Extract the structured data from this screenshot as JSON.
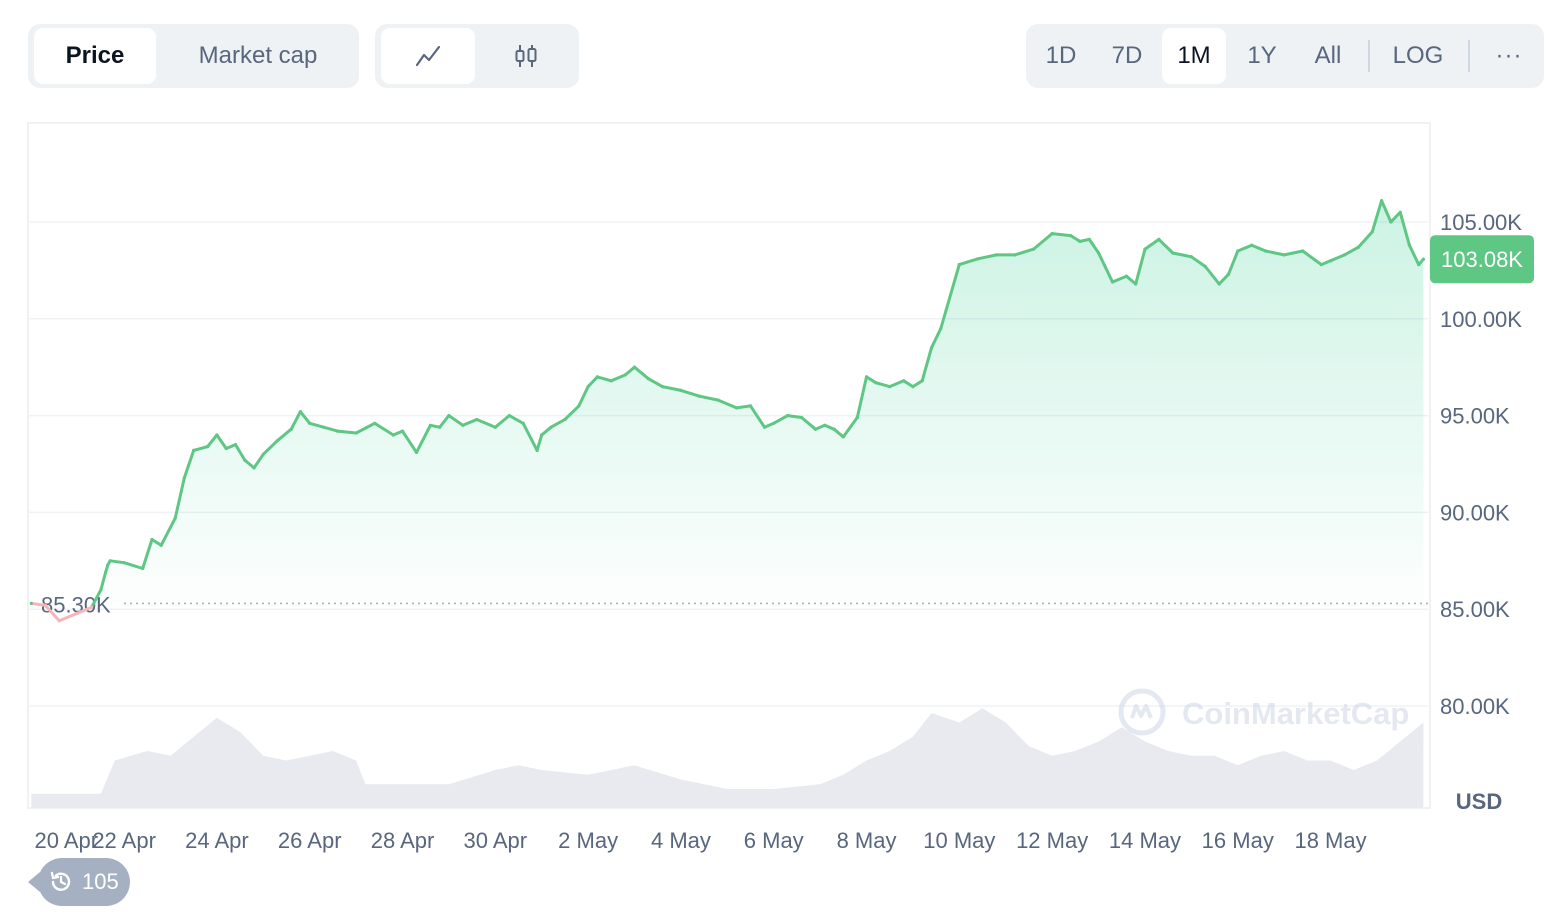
{
  "toolbar": {
    "metric_tabs": [
      {
        "label": "Price",
        "active": true
      },
      {
        "label": "Market cap",
        "active": false
      }
    ],
    "chart_type_buttons": [
      {
        "icon": "line-chart-icon",
        "active": true
      },
      {
        "icon": "candlestick-icon",
        "active": false
      }
    ],
    "timeframes": [
      {
        "label": "1D",
        "active": false
      },
      {
        "label": "7D",
        "active": false
      },
      {
        "label": "1M",
        "active": true
      },
      {
        "label": "1Y",
        "active": false
      },
      {
        "label": "All",
        "active": false
      }
    ],
    "log_label": "LOG",
    "more_label": "···"
  },
  "watermark": "CoinMarketCap",
  "currency_label": "USD",
  "history_badge": {
    "icon": "history-icon",
    "count": "105"
  },
  "colors": {
    "up": "#16c784",
    "line": "#5ec784",
    "down": "#ea3943",
    "grid": "#eff2f5",
    "axis_text": "#58667e",
    "volume": "#e8eaef"
  },
  "chart_data": {
    "type": "area",
    "title": "",
    "xlabel": "",
    "ylabel": "",
    "currency": "USD",
    "ylim": [
      78000,
      110000
    ],
    "y_ticks": [
      "105.00K",
      "100.00K",
      "95.00K",
      "90.00K",
      "85.00K",
      "80.00K"
    ],
    "y_tick_values": [
      105000,
      100000,
      95000,
      90000,
      85000,
      80000
    ],
    "x_tick_labels": [
      "20 Apr",
      "22 Apr",
      "24 Apr",
      "26 Apr",
      "28 Apr",
      "30 Apr",
      "2 May",
      "4 May",
      "6 May",
      "8 May",
      "10 May",
      "12 May",
      "14 May",
      "16 May",
      "18 May"
    ],
    "x_tick_days": [
      0,
      2,
      4,
      6,
      8,
      10,
      12,
      14,
      16,
      18,
      20,
      22,
      24,
      26,
      28
    ],
    "x_range": [
      -0.05,
      30.1
    ],
    "baseline": {
      "value": 85300,
      "label": "85.30K"
    },
    "current": {
      "value": 103080,
      "label": "103.08K"
    },
    "series": [
      {
        "x": [
          0,
          0.3,
          0.6,
          1.0,
          1.3,
          1.5,
          1.6,
          1.65,
          1.7,
          2.0,
          2.4,
          2.6,
          2.8,
          3.1,
          3.3,
          3.5,
          3.8,
          4.0,
          4.2,
          4.4,
          4.6,
          4.8,
          5.0,
          5.3,
          5.6,
          5.8,
          6.0,
          6.3,
          6.6,
          7.0,
          7.4,
          7.8,
          8.0,
          8.3,
          8.6,
          8.8,
          9.0,
          9.3,
          9.6,
          10.0,
          10.3,
          10.6,
          10.9,
          11.0,
          11.2,
          11.5,
          11.8,
          12.0,
          12.2,
          12.5,
          12.8,
          13.0,
          13.3,
          13.6,
          14.0,
          14.4,
          14.8,
          15.2,
          15.5,
          15.8,
          16.0,
          16.3,
          16.6,
          16.9,
          17.1,
          17.3,
          17.5,
          17.8,
          18.0,
          18.2,
          18.5,
          18.8,
          19.0,
          19.2,
          19.4,
          19.6,
          20.0,
          20.4,
          20.8,
          21.2,
          21.6,
          22.0,
          22.4,
          22.6,
          22.8,
          23.0,
          23.3,
          23.6,
          23.8,
          24.0,
          24.3,
          24.6,
          25.0,
          25.3,
          25.6,
          25.8,
          26.0,
          26.3,
          26.6,
          27.0,
          27.4,
          27.8,
          28.0,
          28.3,
          28.6,
          28.9,
          29.1,
          29.3,
          29.5,
          29.7,
          29.9,
          30.0
        ],
        "values": [
          85300,
          85200,
          84400,
          84800,
          85100,
          86000,
          86900,
          87300,
          87500,
          87400,
          87100,
          88600,
          88300,
          89700,
          91800,
          93200,
          93400,
          94000,
          93300,
          93500,
          92700,
          92300,
          93000,
          93700,
          94300,
          95200,
          94600,
          94400,
          94200,
          94100,
          94600,
          94000,
          94200,
          93100,
          94500,
          94400,
          95000,
          94500,
          94800,
          94400,
          95000,
          94600,
          93200,
          94000,
          94400,
          94800,
          95500,
          96500,
          97000,
          96800,
          97100,
          97500,
          96900,
          96500,
          96300,
          96000,
          95800,
          95400,
          95500,
          94400,
          94600,
          95000,
          94900,
          94300,
          94500,
          94300,
          93900,
          94900,
          97000,
          96700,
          96500,
          96800,
          96500,
          96800,
          98500,
          99500,
          102800,
          103100,
          103300,
          103300,
          103600,
          104400,
          104300,
          104000,
          104100,
          103400,
          101900,
          102200,
          101800,
          103600,
          104100,
          103400,
          103200,
          102700,
          101800,
          102300,
          103500,
          103800,
          103500,
          103300,
          103500,
          102800,
          103000,
          103300,
          103700,
          104500,
          106100,
          105000,
          105500,
          103800,
          102800,
          103080
        ]
      }
    ],
    "volume": {
      "x": [
        0,
        1.5,
        1.8,
        2.5,
        3.0,
        3.5,
        4.0,
        4.5,
        5.0,
        5.5,
        6.0,
        6.5,
        7.0,
        7.2,
        8.0,
        9.0,
        10.0,
        10.5,
        11.0,
        12.0,
        13.0,
        14.0,
        15.0,
        16.0,
        17.0,
        17.5,
        18.0,
        18.5,
        19.0,
        19.4,
        20.0,
        20.5,
        21.0,
        21.5,
        22.0,
        22.5,
        23.0,
        23.5,
        24.0,
        24.5,
        25.0,
        25.5,
        26.0,
        26.5,
        27.0,
        27.5,
        28.0,
        28.5,
        29.0,
        29.5,
        30.0
      ],
      "values": [
        0.15,
        0.15,
        0.5,
        0.6,
        0.55,
        0.75,
        0.95,
        0.8,
        0.55,
        0.5,
        0.55,
        0.6,
        0.5,
        0.25,
        0.25,
        0.25,
        0.4,
        0.45,
        0.4,
        0.35,
        0.45,
        0.3,
        0.2,
        0.2,
        0.25,
        0.35,
        0.5,
        0.6,
        0.75,
        1.0,
        0.9,
        1.05,
        0.9,
        0.65,
        0.55,
        0.6,
        0.7,
        0.85,
        0.7,
        0.6,
        0.55,
        0.55,
        0.45,
        0.55,
        0.6,
        0.5,
        0.5,
        0.4,
        0.5,
        0.7,
        0.9
      ]
    }
  }
}
